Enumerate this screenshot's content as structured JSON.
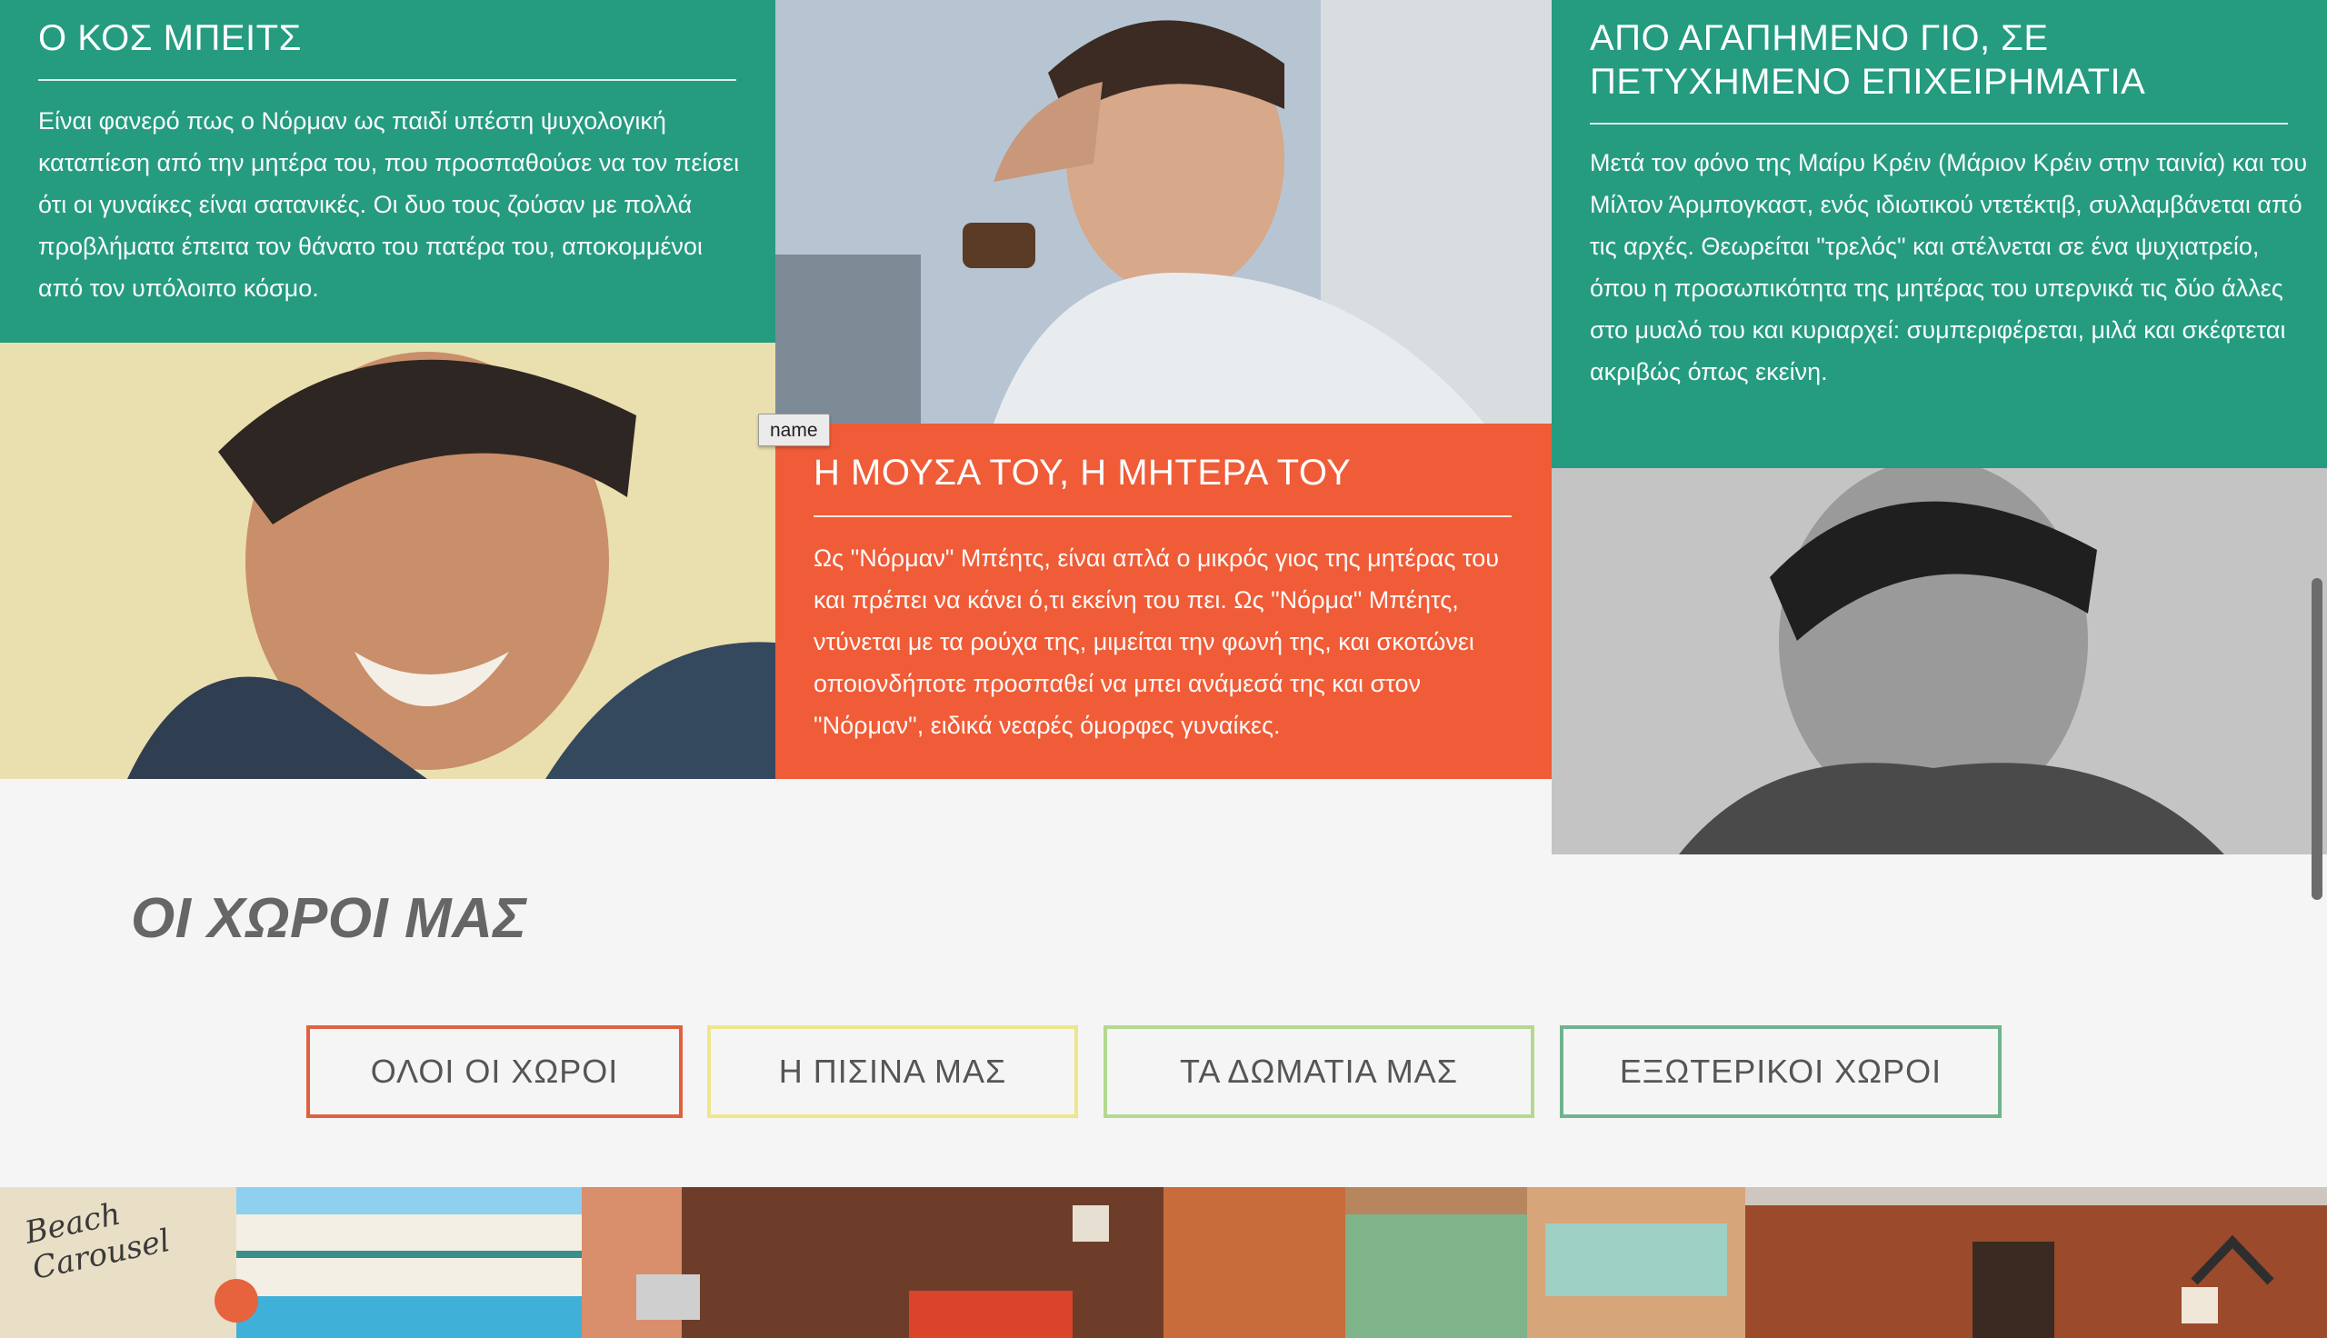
{
  "panels": {
    "top_left": {
      "title": "Ο ΚΟΣ ΜΠΕΙΤΣ",
      "text": "Είναι φανερό πως ο Νόρμαν ως παιδί υπέστη ψυχολογική καταπίεση από την μητέρα του, που προσπαθούσε να τον πείσει ότι οι γυναίκες είναι σατανικές. Οι δυο τους ζούσαν με πολλά προβλήματα έπειτα τον θάνατο του πατέρα του, αποκομμένοι από τον υπόλοιπο κόσμο."
    },
    "middle": {
      "title": "Η ΜΟΥΣΑ ΤΟΥ, Η ΜΗΤΕΡΑ ΤΟΥ",
      "text": "Ως \"Νόρμαν\" Μπέητς, είναι απλά ο μικρός γιος της μητέρας του και πρέπει να κάνει ό,τι εκείνη του πει. Ως \"Νόρμα\" Μπέητς, ντύνεται με τα ρούχα της, μιμείται την φωνή της, και σκοτώνει οποιονδήποτε προσπαθεί να μπει ανάμεσά της και στον \"Νόρμαν\", ειδικά νεαρές όμορφες γυναίκες."
    },
    "top_right": {
      "title": "ΑΠΟ ΑΓΑΠΗΜΕΝΟ ΓΙΟ, ΣΕ ΠΕΤΥΧΗΜΕΝΟ ΕΠΙΧΕΙΡΗΜΑΤΙΑ",
      "text": "Μετά τον φόνο της Μαίρυ Κρέιν (Μάριον Κρέιν στην ταινία) και του Μίλτον Άρμπογκαστ, ενός ιδιωτικού ντετέκτιβ, συλλαμβάνεται από τις αρχές. Θεωρείται \"τρελός\" και στέλνεται σε ένα ψυχιατρείο, όπου η προσωπικότητα της μητέρας του υπερνικά τις δύο άλλες στο μυαλό του και κυριαρχεί: συμπεριφέρεται, μιλά και σκέφτεται ακριβώς όπως εκείνη."
    }
  },
  "tooltip": "name",
  "section": {
    "title": "ΟΙ ΧΩΡΟΙ ΜΑΣ"
  },
  "filters": [
    {
      "label": "ΟΛΟΙ ΟΙ ΧΩΡΟΙ",
      "color": "#e0613f"
    },
    {
      "label": "Η ΠΙΣΙΝΑ ΜΑΣ",
      "color": "#efe58c"
    },
    {
      "label": "ΤΑ ΔΩΜΑΤΙΑ ΜΑΣ",
      "color": "#b3d98f"
    },
    {
      "label": "ΕΞΩΤΕΡΙΚΟΙ ΧΩΡΟΙ",
      "color": "#6fb38f"
    }
  ],
  "gallery": {
    "postcard_text": "Beach Carousel"
  },
  "colors": {
    "green": "#259b80",
    "orange": "#ef5c37",
    "page_bg": "#f5f5f5"
  },
  "icons": {
    "back_to_top": "chevron-up-icon"
  }
}
